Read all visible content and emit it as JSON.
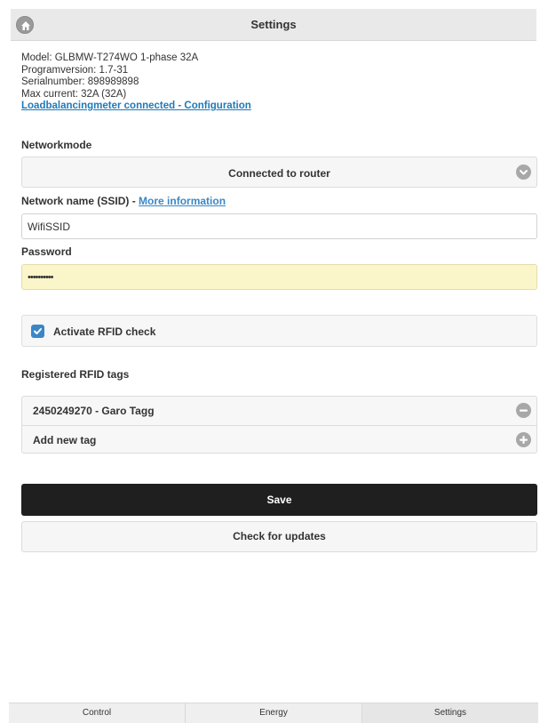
{
  "header": {
    "title": "Settings",
    "home_icon": "home-icon"
  },
  "info": {
    "model": "Model: GLBMW-T274WO 1-phase 32A",
    "program_version": "Programversion: 1.7-31",
    "serial_number": "Serialnumber: 898989898",
    "max_current": "Max current: 32A (32A)",
    "loadbalancing_link": "Loadbalancingmeter connected - Configuration"
  },
  "network_mode": {
    "label": "Networkmode",
    "selected": "Connected to router",
    "icon": "chevron-down-icon"
  },
  "ssid": {
    "label": "Network name (SSID) -",
    "more_info_link": "More information",
    "value": "WifiSSID"
  },
  "password": {
    "label": "Password",
    "value": "••••••••••"
  },
  "rfid": {
    "checkbox_label": "Activate RFID check",
    "checked": true
  },
  "registered_tags": {
    "label": "Registered RFID tags",
    "items": [
      {
        "label": "2450249270 - Garo Tagg",
        "icon": "minus-icon"
      },
      {
        "label": "Add new tag",
        "icon": "plus-icon"
      }
    ]
  },
  "actions": {
    "save_label": "Save",
    "update_label": "Check for updates"
  },
  "tabs": [
    {
      "label": "Control"
    },
    {
      "label": "Energy"
    },
    {
      "label": "Settings"
    }
  ],
  "colors": {
    "link": "#1e7ab8",
    "checkbox": "#3a87c8",
    "save_button": "#1f1f1f",
    "password_bg": "#fbf6c9"
  }
}
